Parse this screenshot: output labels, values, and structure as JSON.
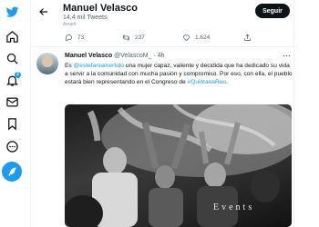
{
  "nav": {
    "items": [
      "twitter-logo",
      "home",
      "explore",
      "notifications",
      "messages",
      "bookmarks",
      "more",
      "compose"
    ],
    "notification_badge": "2",
    "accent": "#1d9bf0"
  },
  "header": {
    "name": "Manuel Velasco",
    "tweet_count": "14,4 mil Tweets",
    "follow_label": "Seguir"
  },
  "previous_tweet": {
    "handle_fragment": "Amarti",
    "replies": "73",
    "retweets": "237",
    "likes": "1.624"
  },
  "tweet": {
    "author": "Manuel Velasco",
    "handle": "@VelascoM_",
    "separator": "·",
    "time": "4h",
    "text_before": "Es ",
    "mention": "@estefaniamerkdo",
    "text_middle": " una mujer capaz, valiente y decidida que ha dedicado su vida a servir a la comunidad con mucha pasión y compromiso. Por eso, con ella, el pueblo estará bien representando en el Congreso de ",
    "hashtag": "#QuintanaRoo",
    "text_end": ".",
    "photo_watermark": "Events"
  }
}
